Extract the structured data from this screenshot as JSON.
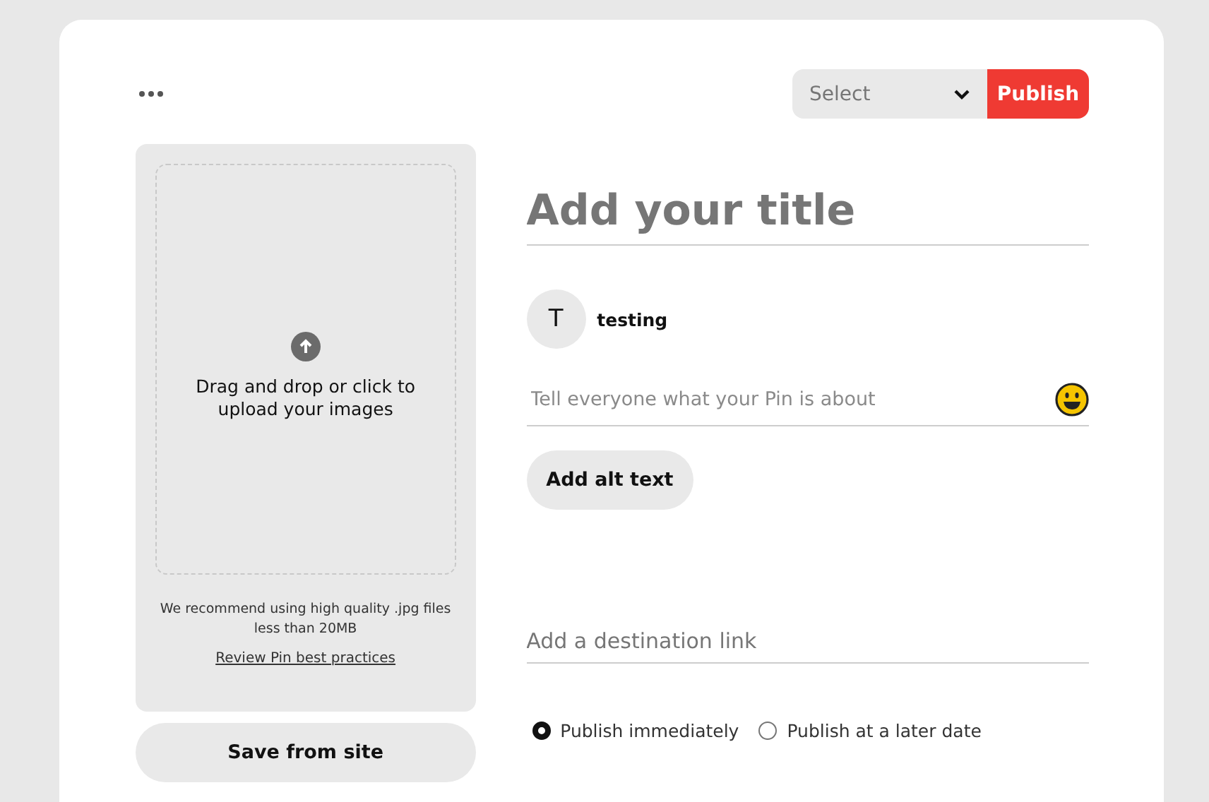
{
  "header": {
    "board_select": {
      "value": "Select"
    },
    "publish_button": "Publish"
  },
  "upload": {
    "prompt": "Drag and drop or click to upload your images",
    "hint": "We recommend using high quality .jpg files less than 20MB",
    "link": "Review Pin best practices"
  },
  "save_button": "Save from site",
  "title": {
    "placeholder": "Add your title"
  },
  "user": {
    "initial": "T",
    "name": "testing"
  },
  "description": {
    "placeholder": "Tell everyone what your Pin is about"
  },
  "alt_text_button": "Add alt text",
  "destination": {
    "placeholder": "Add a destination link"
  },
  "publish_options": [
    {
      "label": "Publish immediately",
      "selected": true
    },
    {
      "label": "Publish at a later date",
      "selected": false
    }
  ]
}
